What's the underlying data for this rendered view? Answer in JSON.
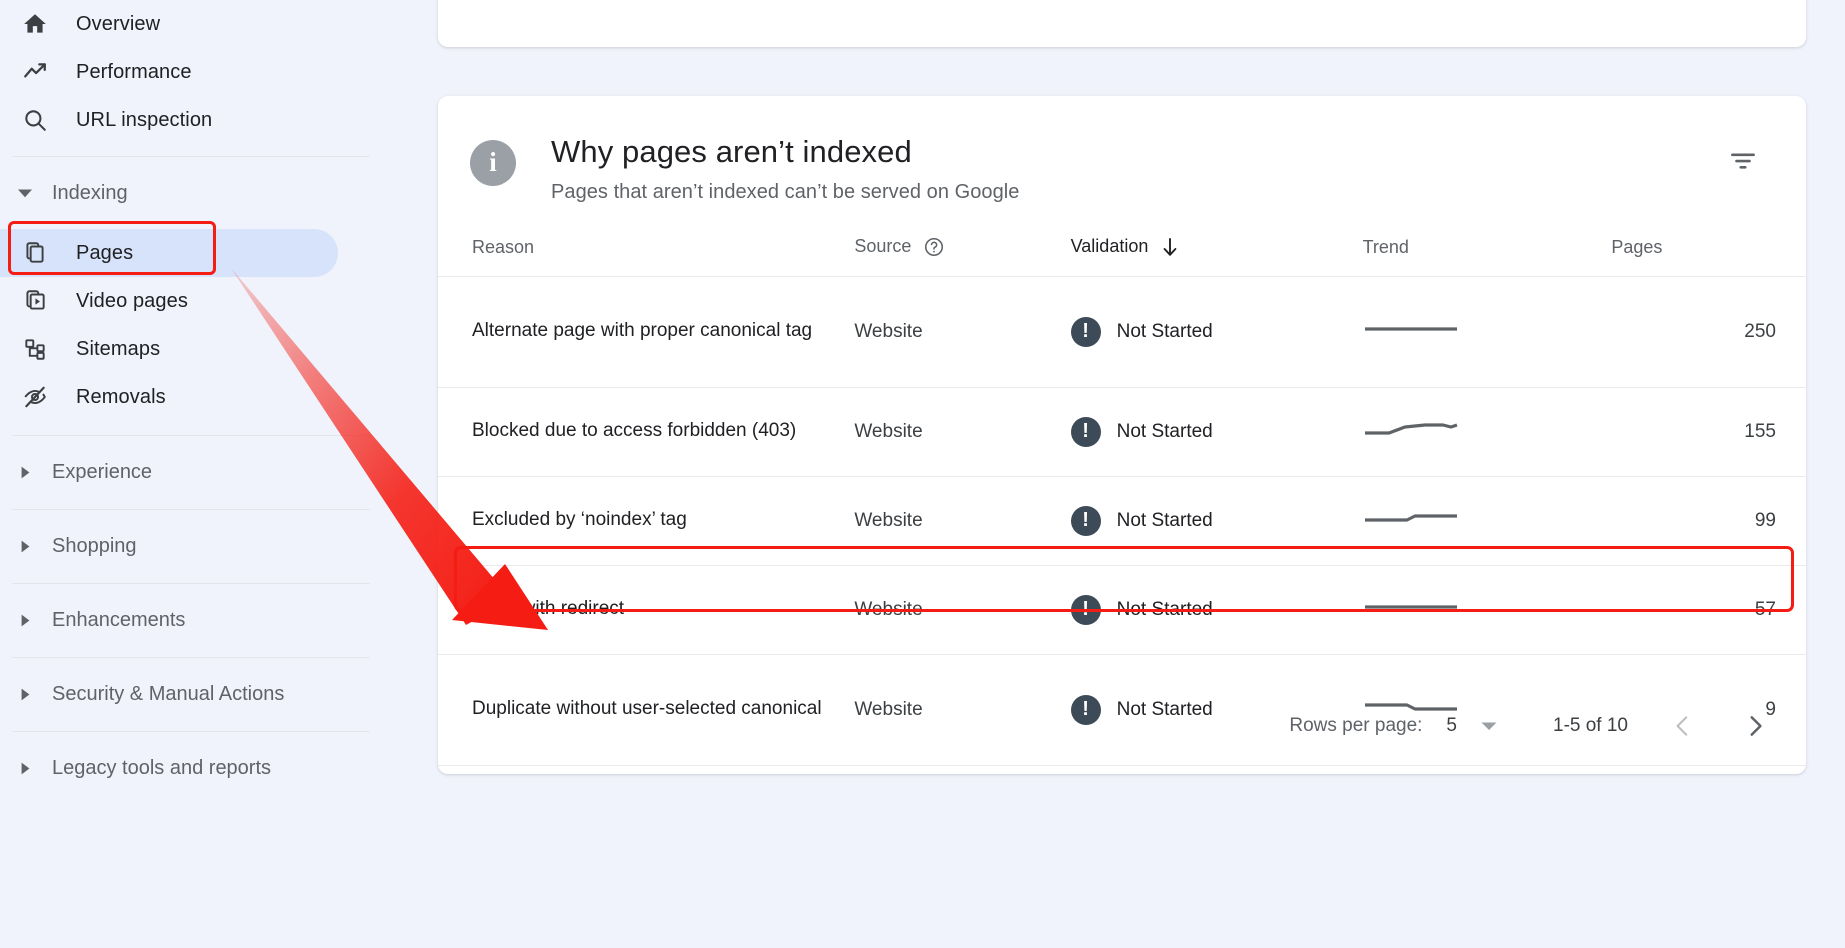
{
  "theme": {
    "page_bg": "#f0f3fb",
    "card_bg": "#ffffff",
    "accent_highlight": "#d7e3fa",
    "annotation_red": "#f41c13",
    "status_icon_bg": "#3c4b57",
    "info_icon_bg": "#9aa0a6",
    "text_primary": "#202124",
    "text_secondary": "#5f6368"
  },
  "sidebar": {
    "items": [
      {
        "label": "Overview",
        "icon": "home-icon",
        "active": false
      },
      {
        "label": "Performance",
        "icon": "trending-up-icon",
        "active": false
      },
      {
        "label": "URL inspection",
        "icon": "search-icon",
        "active": false
      }
    ],
    "indexing_group": {
      "label": "Indexing",
      "expanded": true,
      "icon": "caret-down-icon",
      "items": [
        {
          "label": "Pages",
          "icon": "pages-copy-icon",
          "active": true
        },
        {
          "label": "Video pages",
          "icon": "video-pages-icon",
          "active": false
        },
        {
          "label": "Sitemaps",
          "icon": "sitemap-icon",
          "active": false
        },
        {
          "label": "Removals",
          "icon": "eye-off-icon",
          "active": false
        }
      ]
    },
    "collapsed_groups": [
      {
        "label": "Experience",
        "icon": "caret-right-icon"
      },
      {
        "label": "Shopping",
        "icon": "caret-right-icon"
      },
      {
        "label": "Enhancements",
        "icon": "caret-right-icon"
      },
      {
        "label": "Security & Manual Actions",
        "icon": "caret-right-icon"
      },
      {
        "label": "Legacy tools and reports",
        "icon": "caret-right-icon"
      }
    ]
  },
  "main": {
    "card": {
      "info_icon": "info-icon",
      "info_glyph": "i",
      "title": "Why pages aren’t indexed",
      "subtitle": "Pages that aren’t indexed can’t be served on Google",
      "filter_icon": "filter-icon"
    },
    "table": {
      "columns": [
        {
          "key": "reason",
          "label": "Reason",
          "icon": null,
          "sorted": false
        },
        {
          "key": "source",
          "label": "Source",
          "icon": "help-circle-icon",
          "sorted": false
        },
        {
          "key": "validation",
          "label": "Validation",
          "icon": "sort-desc-arrow-icon",
          "sorted": true
        },
        {
          "key": "trend",
          "label": "Trend",
          "icon": null,
          "sorted": false
        },
        {
          "key": "pages",
          "label": "Pages",
          "icon": null,
          "sorted": false
        }
      ],
      "rows": [
        {
          "reason": "Alternate page with proper canonical tag",
          "source": "Website",
          "validation": "Not Started",
          "status_icon": "exclamation-circle-icon",
          "trend": "flat",
          "pages": "250",
          "highlighted": false
        },
        {
          "reason": "Blocked due to access forbidden (403)",
          "source": "Website",
          "validation": "Not Started",
          "status_icon": "exclamation-circle-icon",
          "trend": "rising",
          "pages": "155",
          "highlighted": false
        },
        {
          "reason": "Excluded by ‘noindex’ tag",
          "source": "Website",
          "validation": "Not Started",
          "status_icon": "exclamation-circle-icon",
          "trend": "step-up",
          "pages": "99",
          "highlighted": false
        },
        {
          "reason": "Page with redirect",
          "source": "Website",
          "validation": "Not Started",
          "status_icon": "exclamation-circle-icon",
          "trend": "flat",
          "pages": "57",
          "highlighted": true
        },
        {
          "reason": "Duplicate without user-selected canonical",
          "source": "Website",
          "validation": "Not Started",
          "status_icon": "exclamation-circle-icon",
          "trend": "step-down",
          "pages": "9",
          "highlighted": false
        }
      ]
    },
    "footer": {
      "rows_per_page_label": "Rows per page:",
      "rows_per_page_value": "5",
      "rows_per_page_icon": "chevron-down-icon",
      "range_label": "1-5 of 10",
      "prev_icon": "chevron-left-icon",
      "next_icon": "chevron-right-icon"
    }
  },
  "annotations": {
    "arrow": {
      "icon": "red-arrow-icon",
      "color": "#f41c13"
    },
    "pages_box": {
      "color": "#f41c13"
    },
    "row_box": {
      "color": "#f41c13"
    }
  },
  "chart_data": {
    "type": "table",
    "title": "Why pages aren’t indexed",
    "columns": [
      "Reason",
      "Source",
      "Validation",
      "Trend",
      "Pages"
    ],
    "rows": [
      [
        "Alternate page with proper canonical tag",
        "Website",
        "Not Started",
        "flat",
        250
      ],
      [
        "Blocked due to access forbidden (403)",
        "Website",
        "Not Started",
        "rising",
        155
      ],
      [
        "Excluded by ‘noindex’ tag",
        "Website",
        "Not Started",
        "step-up",
        99
      ],
      [
        "Page with redirect",
        "Website",
        "Not Started",
        "flat",
        57
      ],
      [
        "Duplicate without user-selected canonical",
        "Website",
        "Not Started",
        "step-down",
        9
      ]
    ],
    "total_rows": 10,
    "shown_rows": 5
  }
}
